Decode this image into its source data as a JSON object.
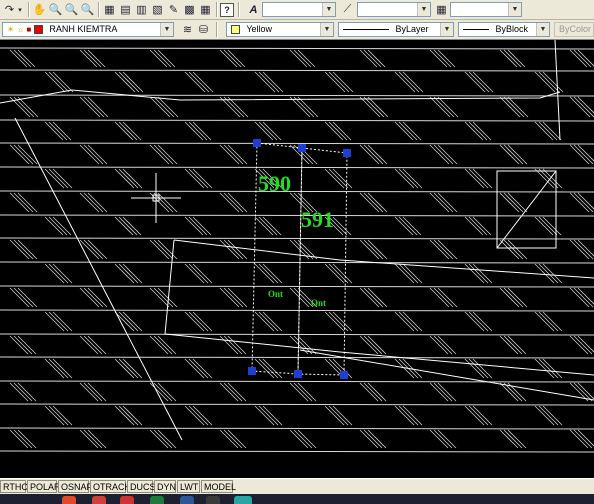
{
  "toolbar1": {
    "icons": [
      "redo-icon",
      "dropdown-arrow-icon",
      "pan-icon",
      "zoom-realtime-icon",
      "zoom-window-icon",
      "zoom-previous-icon",
      "properties-icon",
      "design-center-icon",
      "tool-palettes-icon",
      "sheet-set-icon",
      "markup-icon",
      "calculator-icon",
      "help-icon",
      "text-style-icon",
      "dimension-style-icon"
    ],
    "text_style_value": "",
    "dim_style_value": "",
    "table_style_value": ""
  },
  "toolbar2": {
    "layer_value": "RANH KIEMTRA",
    "color_value": "Yellow",
    "color_hex": "#ffff80",
    "linetype_value": "ByLayer",
    "lineweight_value": "ByBlock",
    "plotstyle_value": "ByColor"
  },
  "drawing": {
    "label_590": "590",
    "label_591": "591",
    "label_ont_1": "Ont",
    "label_ont_2": "Ont",
    "text_color": "#22dd22",
    "grip_color": "#1f3fd0",
    "line_color": "#ffffff"
  },
  "statusbar": {
    "buttons": [
      "RTHO",
      "POLAR",
      "OSNAP",
      "OTRACK",
      "DUCS",
      "DYN",
      "LWT",
      "MODEL"
    ]
  },
  "taskbar": {
    "icons": [
      "chrome-icon",
      "app-icon",
      "foxit-icon",
      "excel-icon",
      "word-icon",
      "autocad-icon",
      "folder-icon"
    ]
  }
}
